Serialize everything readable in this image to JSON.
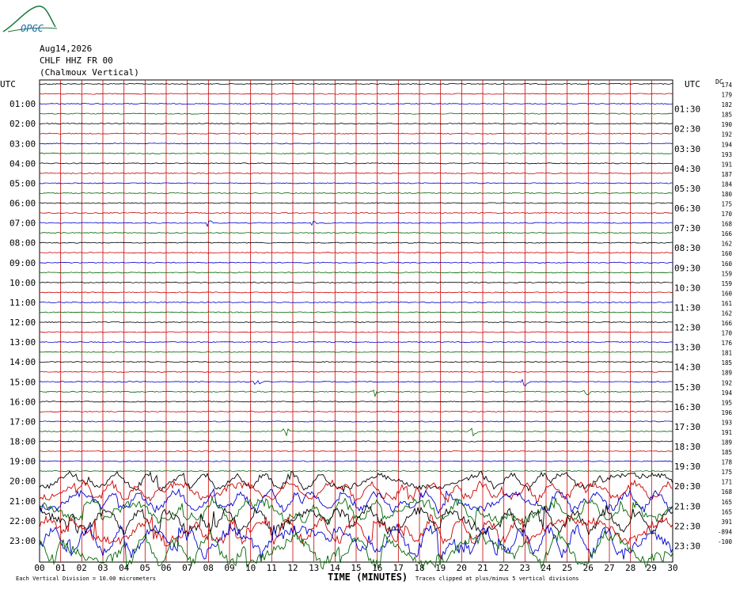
{
  "logo": {
    "text": "OPGC",
    "color": "#1a7a3a"
  },
  "header": {
    "date": "Aug14,2026",
    "channel": "CHLF HHZ FR 00",
    "station": "(Chalmoux Vertical)"
  },
  "axis": {
    "left_label": "UTC",
    "right_label": "UTC",
    "dc_label": "DC",
    "xlabel": "TIME (MINUTES)"
  },
  "footer": {
    "division_note": "Each Vertical Division = 10.00 micrometers",
    "clip_note": "Traces clipped at plus/minus 5 vertical divisions"
  },
  "chart_data": {
    "type": "line",
    "description_units": "helicorder: 48 traces of 30 minutes each",
    "x_ticks": [
      "00",
      "01",
      "02",
      "03",
      "04",
      "05",
      "06",
      "07",
      "08",
      "09",
      "10",
      "11",
      "12",
      "13",
      "14",
      "15",
      "16",
      "17",
      "18",
      "19",
      "20",
      "21",
      "22",
      "23",
      "24",
      "25",
      "26",
      "27",
      "28",
      "29",
      "30"
    ],
    "xlim": [
      0,
      30
    ],
    "left_hour_labels": [
      "01:00",
      "02:00",
      "03:00",
      "04:00",
      "05:00",
      "06:00",
      "07:00",
      "08:00",
      "09:00",
      "10:00",
      "11:00",
      "12:00",
      "13:00",
      "14:00",
      "15:00",
      "16:00",
      "17:00",
      "18:00",
      "19:00",
      "20:00",
      "21:00",
      "22:00",
      "23:00"
    ],
    "right_half_labels": [
      "01:30",
      "02:30",
      "03:30",
      "04:30",
      "05:30",
      "06:30",
      "07:30",
      "08:30",
      "09:30",
      "10:30",
      "11:30",
      "12:30",
      "13:30",
      "14:30",
      "15:30",
      "16:30",
      "17:30",
      "18:30",
      "19:30",
      "20:30",
      "21:30",
      "22:30",
      "23:30"
    ],
    "dc_offsets": [
      "174",
      "179",
      "182",
      "185",
      "190",
      "192",
      "194",
      "193",
      "191",
      "187",
      "184",
      "180",
      "175",
      "170",
      "168",
      "166",
      "162",
      "160",
      "160",
      "159",
      "159",
      "160",
      "161",
      "162",
      "166",
      "170",
      "176",
      "181",
      "185",
      "189",
      "192",
      "194",
      "195",
      "196",
      "193",
      "191",
      "189",
      "185",
      "178",
      "175",
      "171",
      "168",
      "165",
      "165",
      "391",
      "-894",
      "-100"
    ],
    "trace_colors": [
      "#000000",
      "#cc0000",
      "#0000cc",
      "#006600"
    ],
    "grid_color": "#cc0000",
    "events": [
      {
        "trace": 14,
        "minute": 8.0,
        "amp": 3
      },
      {
        "trace": 14,
        "minute": 13.0,
        "amp": 3
      },
      {
        "trace": 30,
        "minute": 10.3,
        "amp": 4
      },
      {
        "trace": 30,
        "minute": 23.0,
        "amp": 4
      },
      {
        "trace": 31,
        "minute": 15.9,
        "amp": 4
      },
      {
        "trace": 31,
        "minute": 25.9,
        "amp": 5
      },
      {
        "trace": 35,
        "minute": 11.7,
        "amp": 5
      },
      {
        "trace": 35,
        "minute": 20.6,
        "amp": 6
      }
    ],
    "noise_start_trace": 40
  }
}
